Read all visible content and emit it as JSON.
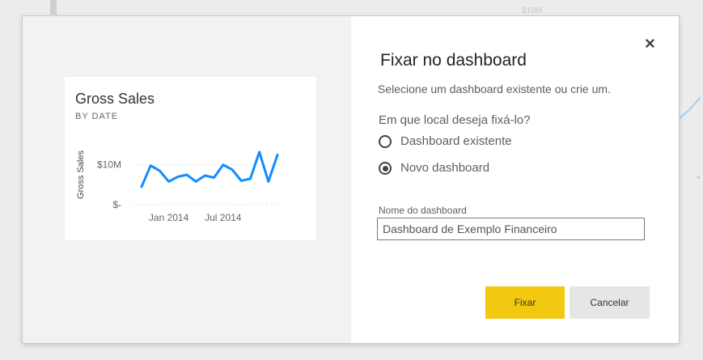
{
  "background": {
    "label": "$10M"
  },
  "dialog": {
    "title": "Fixar no dashboard",
    "subtitle": "Selecione um dashboard existente ou crie um.",
    "question": "Em que local deseja fixá-lo?",
    "options": [
      {
        "label": "Dashboard existente",
        "selected": false
      },
      {
        "label": "Novo dashboard",
        "selected": true
      }
    ],
    "field_label": "Nome do dashboard",
    "field_value": "Dashboard de Exemplo Financeiro",
    "pin_label": "Fixar",
    "cancel_label": "Cancelar",
    "close_icon": "×"
  },
  "tile": {
    "title": "Gross Sales",
    "subtitle": "BY DATE"
  },
  "colors": {
    "accent": "#f2c811",
    "line": "#118dff"
  },
  "chart_data": {
    "type": "line",
    "title": "Gross Sales",
    "subtitle": "BY DATE",
    "ylabel": "Gross Sales",
    "ytick_labels": [
      "$10M",
      "$-"
    ],
    "yticks": [
      10,
      0
    ],
    "xtick_labels": [
      "Jan 2014",
      "Jul 2014"
    ],
    "xticks": [
      3,
      9
    ],
    "x": [
      0,
      1,
      2,
      3,
      4,
      5,
      6,
      7,
      8,
      9,
      10,
      11,
      12,
      13,
      14,
      15
    ],
    "values": [
      4.5,
      9.8,
      8.5,
      5.8,
      7.0,
      7.5,
      5.8,
      7.3,
      6.8,
      10.0,
      8.8,
      6.0,
      6.5,
      13.2,
      5.8,
      12.5
    ],
    "ylim": [
      0,
      14
    ],
    "xlim": [
      0,
      15
    ],
    "grid": true
  }
}
